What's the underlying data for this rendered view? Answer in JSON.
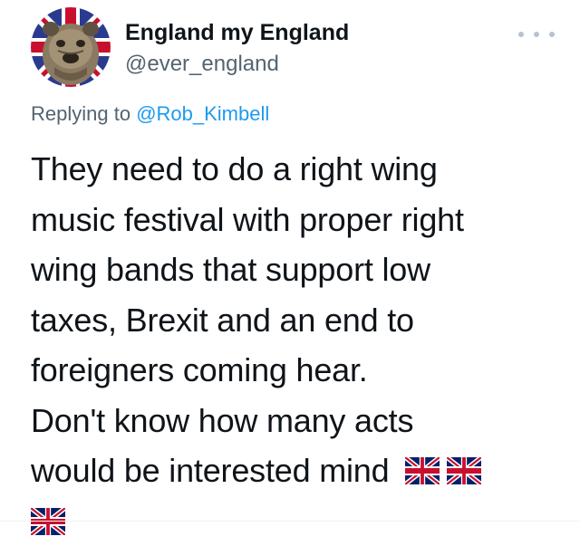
{
  "tweet": {
    "author": {
      "name": "England my England",
      "handle": "@ever_england",
      "avatar_icon": "bulldog-union-jack-avatar"
    },
    "reply_prefix": "Replying to ",
    "reply_to": "@Rob_Kimbell",
    "text_lines": [
      "They need to do a right wing",
      "music festival with proper right",
      "wing bands that support low",
      "taxes, Brexit and an end to",
      "foreigners coming hear.",
      "Don't know how many acts",
      "would be interested mind"
    ],
    "emoji": [
      "union-jack-flag",
      "union-jack-flag",
      "union-jack-flag"
    ],
    "more_icon": "more-options-icon"
  },
  "colors": {
    "text": "#0f1419",
    "secondary": "#536471",
    "link": "#1d9bf0",
    "flag_blue": "#012169",
    "flag_red": "#C8102E"
  }
}
